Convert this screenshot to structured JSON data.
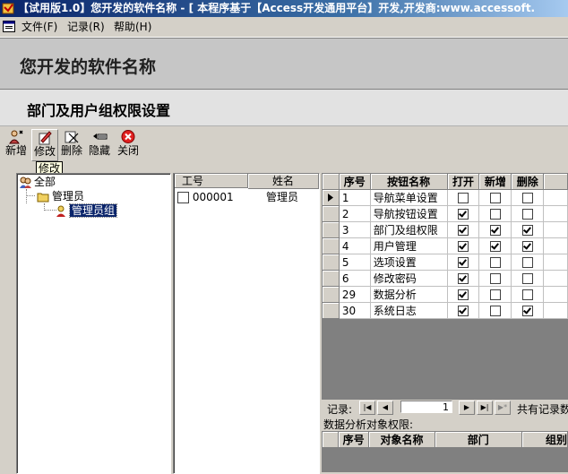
{
  "window": {
    "title": "【试用版1.0】您开发的软件名称 - [ 本程序基于【Access开发通用平台】开发,开发商:www.accessoft."
  },
  "menu": {
    "items": [
      {
        "label": "文件(F)"
      },
      {
        "label": "记录(R)"
      },
      {
        "label": "帮助(H)"
      }
    ]
  },
  "banner": {
    "title": "您开发的软件名称"
  },
  "page": {
    "title": "部门及用户组权限设置"
  },
  "toolbar": {
    "buttons": [
      {
        "label": "新增",
        "icon": "new-icon"
      },
      {
        "label": "修改",
        "icon": "edit-icon"
      },
      {
        "label": "删除",
        "icon": "delete-icon"
      },
      {
        "label": "隐藏",
        "icon": "hide-icon"
      },
      {
        "label": "关闭",
        "icon": "close-icon"
      }
    ],
    "tooltip": "修改"
  },
  "tree": {
    "root": "全部",
    "dept": "管理员",
    "group": "管理员组"
  },
  "users": {
    "headers": [
      "工号",
      "姓名"
    ],
    "rows": [
      {
        "id": "000001",
        "name": "管理员",
        "checked": false
      }
    ]
  },
  "grid": {
    "headers": [
      "序号",
      "按钮名称",
      "打开",
      "新增",
      "删除"
    ],
    "rows": [
      {
        "no": "1",
        "name": "导航菜单设置",
        "open": false,
        "add": false,
        "del": false
      },
      {
        "no": "2",
        "name": "导航按钮设置",
        "open": true,
        "add": false,
        "del": false
      },
      {
        "no": "3",
        "name": "部门及组权限",
        "open": true,
        "add": true,
        "del": true
      },
      {
        "no": "4",
        "name": "用户管理",
        "open": true,
        "add": true,
        "del": true
      },
      {
        "no": "5",
        "name": "选项设置",
        "open": true,
        "add": false,
        "del": false
      },
      {
        "no": "6",
        "name": "修改密码",
        "open": true,
        "add": false,
        "del": false
      },
      {
        "no": "29",
        "name": "数据分析",
        "open": true,
        "add": false,
        "del": false
      },
      {
        "no": "30",
        "name": "系统日志",
        "open": true,
        "add": false,
        "del": true
      }
    ]
  },
  "nav": {
    "label": "记录:",
    "current": "1",
    "total_text": "共有记录数"
  },
  "sub": {
    "caption": "数据分析对象权限:",
    "headers": [
      "序号",
      "对象名称",
      "部门",
      "组别"
    ]
  }
}
